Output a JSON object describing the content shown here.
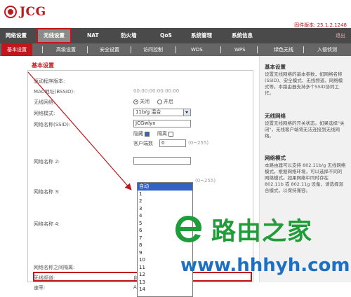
{
  "brand": {
    "logo_text": "JCG",
    "firmware": "固件版本: 25.1.2.1248"
  },
  "main_nav": {
    "items": [
      "网络设置",
      "无线设置",
      "NAT",
      "防火墙",
      "QoS",
      "系统管理",
      "系统信息"
    ],
    "active_index": 1,
    "logout": "退出"
  },
  "sub_nav": {
    "items": [
      "基本设置",
      "高级设置",
      "安全设置",
      "访问控制",
      "WDS",
      "WPS",
      "绿色无线",
      "入侵侦测"
    ],
    "active_index": 0
  },
  "section": {
    "title": "基本设置"
  },
  "form": {
    "firmware_label": "驱动程序版本:",
    "mac_label": "MAC地址(BSSID):",
    "mac_value": "00:00:00:00:00:00",
    "wireless_label": "无线网络:",
    "radio_off": "关闭",
    "radio_on": "开启",
    "mode_label": "网络模式:",
    "mode_value": "11b/g 混合",
    "ssid1_label": "网络名称(SSID):",
    "ssid1_value": "JCGwlyx",
    "hide_label": "隐藏",
    "isolate_label": "隔离",
    "client_count_label": "客户端数",
    "client_count_value": "0",
    "client_count_range": "(0~255)",
    "ssid2_label": "网络名称 2:",
    "ssid2_range": "(0~255)",
    "ssid3_label": "网络名称 3:",
    "ssid4_label": "网络名称 4:",
    "ssid_isolate_label": "网络名称之间隔离:",
    "channel_label": "无线频道:",
    "channel_value": "自动",
    "rate_label": "速率:",
    "rate_value": "Auto"
  },
  "channel_dropdown": {
    "options": [
      "自动",
      "1",
      "2",
      "3",
      "4",
      "5",
      "6",
      "7",
      "8",
      "9",
      "10",
      "11",
      "12",
      "13",
      "14"
    ],
    "highlighted_index": 0
  },
  "sidebar": {
    "sections": [
      {
        "heading": "基本设置",
        "text": "设置无线网络的基本参数，如网络名称 (SSID)、安全模式、无线频道、网络模式等。本路由器支持多个SSID协同工作。"
      },
      {
        "heading": "无线网络",
        "text": "设置无线网络的开关状态。如果选择\"关闭\"，无线客户端将无法连接到无线网络。"
      },
      {
        "heading": "网络模式",
        "text": "本路由器可以支持 802.11b/g 无线网络模式，根据网络环境，可以选择不同的网络模式。如果网络中同时存在 802.11b 或 802.11g 设备，请选择混合模式，以保持兼容。"
      }
    ]
  },
  "watermark": {
    "title": "路由之家",
    "url": "www.hhhyh.com"
  },
  "colors": {
    "brand_red": "#c0161c",
    "nav_dark": "#4a4a4a",
    "watermark_green": "#1f9d3a",
    "watermark_blue": "#1d6fc1"
  }
}
